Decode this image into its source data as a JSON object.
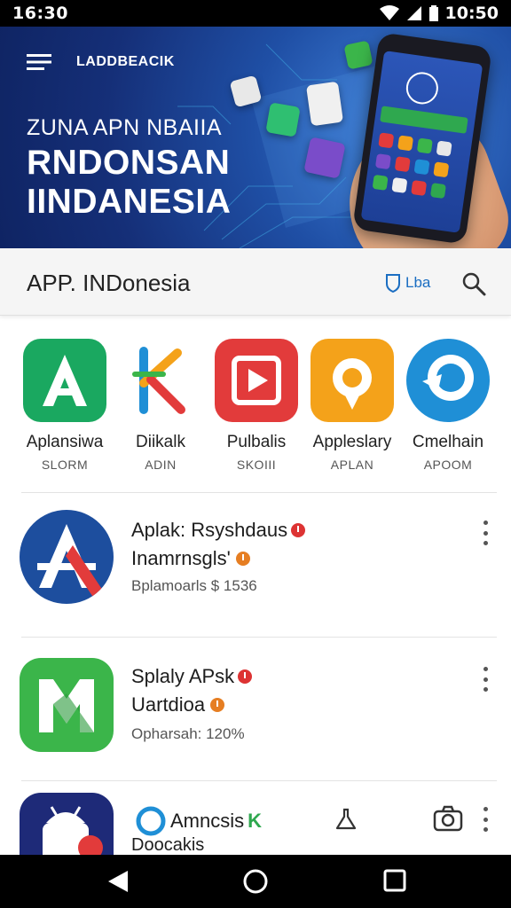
{
  "status_bar": {
    "time_left": "16:30",
    "time_right": "10:50"
  },
  "banner": {
    "brand": "LADDBEACIK",
    "subtitle": "ZUNA APN NBAIIA",
    "title_line1": "RNDONSAN",
    "title_line2": "IINDANESIA"
  },
  "app_bar": {
    "title": "APP. INDonesia",
    "lang_label": "Lba"
  },
  "featured": [
    {
      "name": "Aplansiwa",
      "sub": "SLORM",
      "color": "#1aa860",
      "icon": "letter-a-icon"
    },
    {
      "name": "Diikalk",
      "sub": "ADIN",
      "color": "#f2f2f2",
      "icon": "colorful-k-icon"
    },
    {
      "name": "Pulbalis",
      "sub": "SKOIII",
      "color": "#e23b3b",
      "icon": "play-icon"
    },
    {
      "name": "Appleslary",
      "sub": "APLAN",
      "color": "#f4a21a",
      "icon": "location-pin-icon"
    },
    {
      "name": "Cmelhain",
      "sub": "APOOM",
      "color": "#1f8fd6",
      "icon": "chat-bubble-icon"
    }
  ],
  "list": [
    {
      "title": "Aplak: Rsyshdaus",
      "subtitle": "Inamrnsgls'",
      "meta": "Bplamoarls $ 1536",
      "icon": "letter-a-icon",
      "color": "#1d4e9e"
    },
    {
      "title": "Splaly APsk",
      "subtitle": "Uartdioa",
      "meta": "Opharsah: 120%",
      "icon": "letter-m-icon",
      "color": "#3bb54a"
    },
    {
      "title": "Amncsis",
      "title_suffix": "K",
      "subtitle": "Doocakis",
      "icon": "android-icon",
      "color": "#1e2a78"
    }
  ]
}
